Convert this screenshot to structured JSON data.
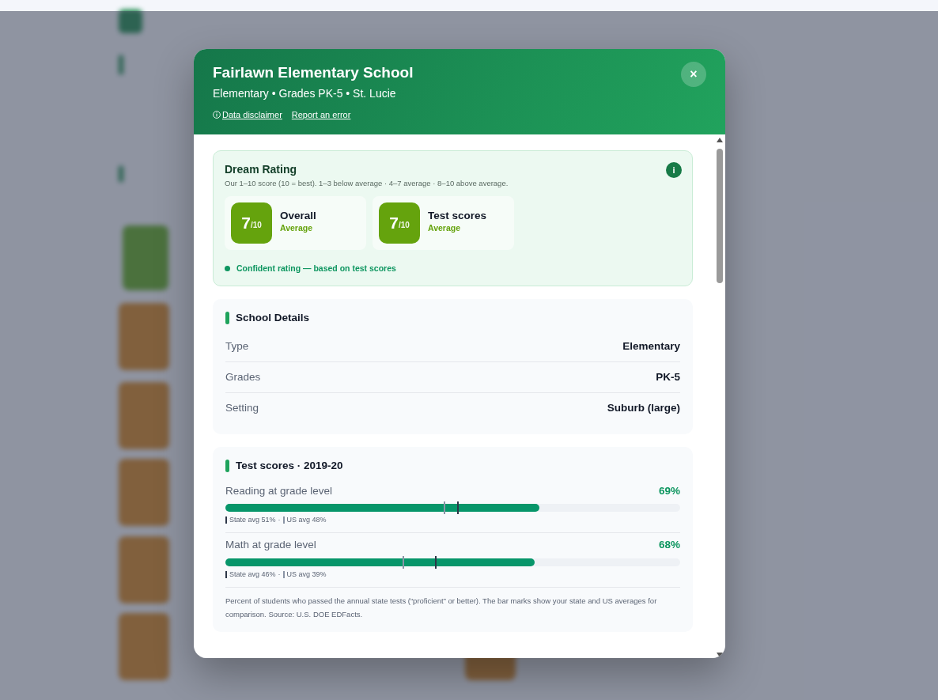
{
  "modal": {
    "title": "Fairlawn Elementary School",
    "subtitle": "Elementary • Grades PK-5 • St. Lucie",
    "links": [
      {
        "label": "Data disclaimer",
        "kind": "info"
      },
      {
        "label": "Report an error",
        "kind": "plain"
      }
    ],
    "close": "×"
  },
  "dream_rating": {
    "title": "Dream Rating",
    "info": "i",
    "description": "Our 1–10 score (10 = best). 1–3 below average · 4–7 average · 8–10 above average.",
    "ratings": [
      {
        "score": "7",
        "out_of": "/10",
        "label": "Overall",
        "level_text": "Average",
        "color": "#65a30d"
      },
      {
        "score": "7",
        "out_of": "/10",
        "label": "Test scores",
        "level_text": "Average",
        "color": "#65a30d"
      }
    ],
    "confidence": "Confident rating — based on test scores"
  },
  "school_details": {
    "title": "School Details",
    "rows": [
      {
        "label": "Type",
        "value": "Elementary"
      },
      {
        "label": "Grades",
        "value": "PK-5"
      },
      {
        "label": "Setting",
        "value": "Suburb (large)"
      }
    ]
  },
  "test_scores": {
    "title": "Test scores · 2019-20",
    "items": [
      {
        "label": "Reading at grade level",
        "value": "69%",
        "level": 0.69,
        "state_marker": {
          "level": 0.51
        },
        "us_marker": {
          "level": 0.48
        },
        "state_text": "State avg 51%",
        "separator": "·",
        "us_text": "US avg 48%"
      },
      {
        "label": "Math at grade level",
        "value": "68%",
        "level": 0.68,
        "state_marker": {
          "level": 0.46
        },
        "us_marker": {
          "level": 0.39
        },
        "state_text": "State avg 46%",
        "separator": "·",
        "us_text": "US avg 39%"
      }
    ],
    "note": "Percent of students who passed the annual state tests (“proficient” or better). The bar marks show your state and US averages for comparison. Source: U.S. DOE EDFacts."
  }
}
